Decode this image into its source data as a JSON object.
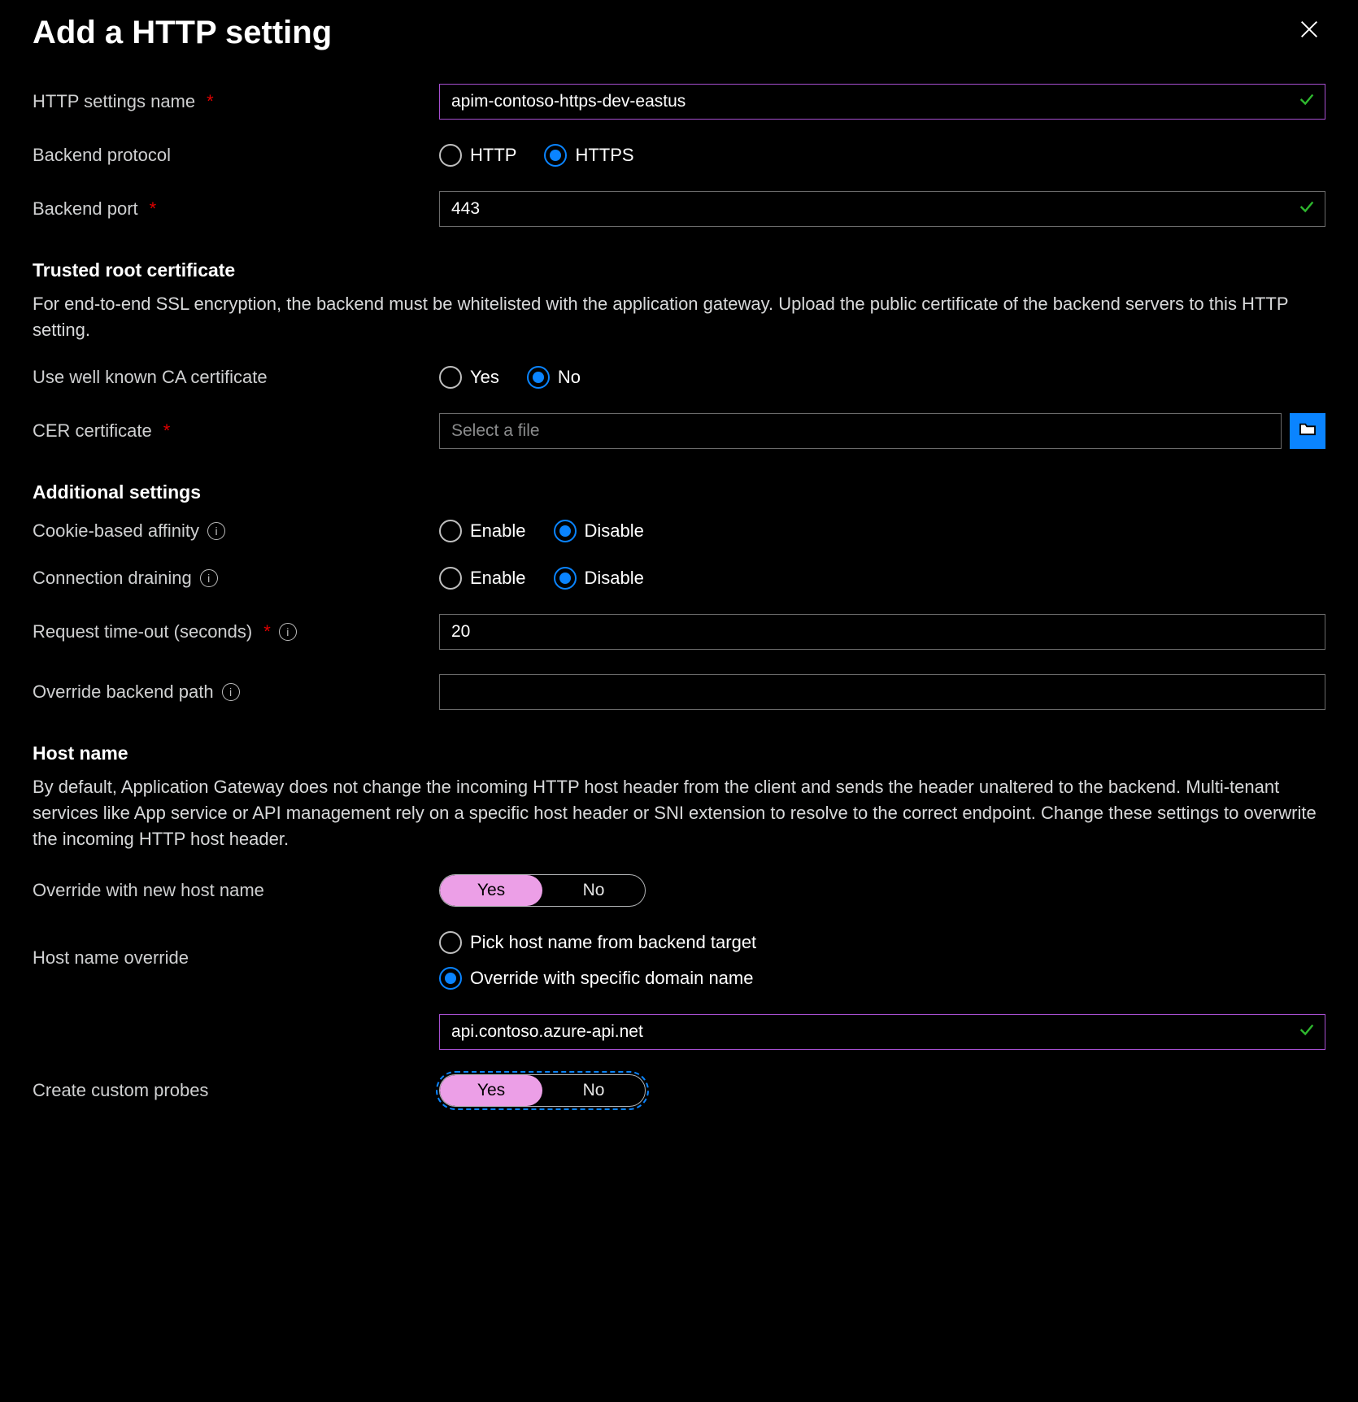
{
  "header": {
    "title": "Add a HTTP setting"
  },
  "fields": {
    "http_settings_name": {
      "label": "HTTP settings name",
      "value": "apim-contoso-https-dev-eastus"
    },
    "backend_protocol": {
      "label": "Backend protocol",
      "opt_http": "HTTP",
      "opt_https": "HTTPS"
    },
    "backend_port": {
      "label": "Backend port",
      "value": "443"
    }
  },
  "trusted_root": {
    "heading": "Trusted root certificate",
    "desc": "For end-to-end SSL encryption, the backend must be whitelisted with the application gateway. Upload the public certificate of the backend servers to this HTTP setting.",
    "use_known_ca": {
      "label": "Use well known CA certificate",
      "opt_yes": "Yes",
      "opt_no": "No"
    },
    "cer_cert": {
      "label": "CER certificate",
      "placeholder": "Select a file"
    }
  },
  "additional": {
    "heading": "Additional settings",
    "cookie_affinity": {
      "label": "Cookie-based affinity",
      "opt_enable": "Enable",
      "opt_disable": "Disable"
    },
    "connection_draining": {
      "label": "Connection draining",
      "opt_enable": "Enable",
      "opt_disable": "Disable"
    },
    "request_timeout": {
      "label": "Request time-out (seconds)",
      "value": "20"
    },
    "override_backend_path": {
      "label": "Override backend path",
      "value": ""
    }
  },
  "host": {
    "heading": "Host name",
    "desc": "By default, Application Gateway does not change the incoming HTTP host header from the client and sends the header unaltered to the backend. Multi-tenant services like App service or API management rely on a specific host header or SNI extension to resolve to the correct endpoint. Change these settings to overwrite the incoming HTTP host header.",
    "override_new_host": {
      "label": "Override with new host name",
      "opt_yes": "Yes",
      "opt_no": "No"
    },
    "host_override": {
      "label": "Host name override",
      "opt_pick": "Pick host name from backend target",
      "opt_specific": "Override with specific domain name",
      "value": "api.contoso.azure-api.net"
    },
    "create_probes": {
      "label": "Create custom probes",
      "opt_yes": "Yes",
      "opt_no": "No"
    }
  }
}
